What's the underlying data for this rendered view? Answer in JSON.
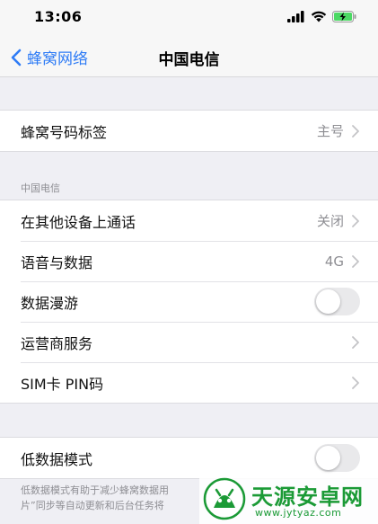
{
  "status_bar": {
    "time": "13:06"
  },
  "nav": {
    "back_label": "蜂窝网络",
    "title": "中国电信"
  },
  "group1": {
    "rows": [
      {
        "label": "蜂窝号码标签",
        "value": "主号"
      }
    ]
  },
  "group2": {
    "header": "中国电信",
    "rows": [
      {
        "label": "在其他设备上通话",
        "value": "关闭"
      },
      {
        "label": "语音与数据",
        "value": "4G"
      },
      {
        "label": "数据漫游",
        "toggle": false
      },
      {
        "label": "运营商服务",
        "value": ""
      },
      {
        "label": "SIM卡 PIN码",
        "value": ""
      }
    ]
  },
  "group3": {
    "rows": [
      {
        "label": "低数据模式",
        "toggle": false
      }
    ],
    "footer": "低数据模式有助于减少蜂窝数据用",
    "footer2": "片”同步等自动更新和后台任务将"
  },
  "watermark": {
    "title": "天源安卓网",
    "url": "www.jytyaz.com"
  },
  "colors": {
    "accent": "#2f7cf6",
    "background": "#efeff4",
    "secondary_text": "#8e8e93",
    "watermark_green": "#1b9a36"
  }
}
